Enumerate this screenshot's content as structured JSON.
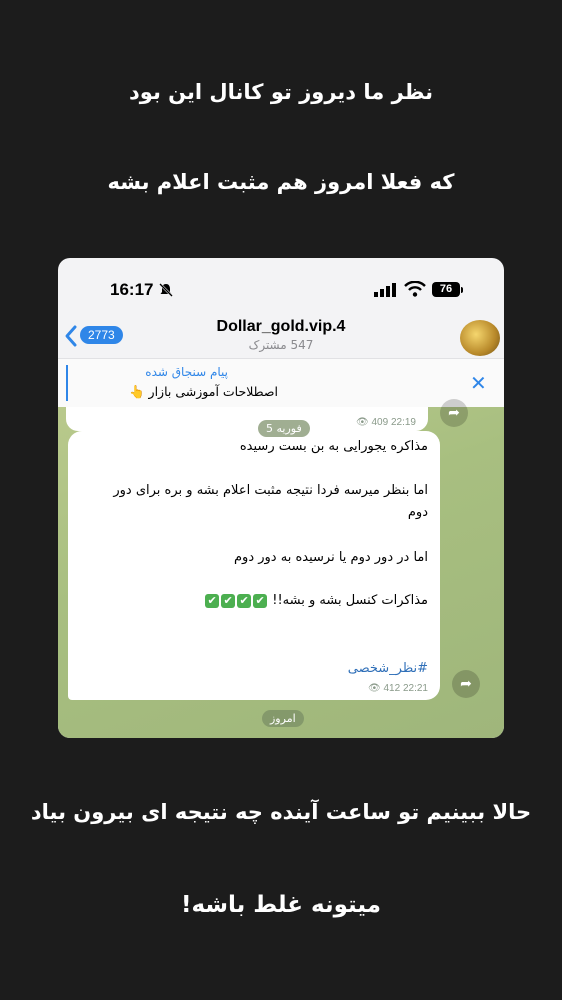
{
  "captions": {
    "line1": "نظر ما دیروز تو کانال این بود",
    "line2": "که فعلا امروز هم مثبت اعلام بشه",
    "line3": "حالا ببینیم تو ساعت آینده چه نتیجه ای بیرون بیاد",
    "line4": "میتونه غلط باشه!"
  },
  "status_bar": {
    "time": "16:17",
    "battery": "76"
  },
  "header": {
    "back_badge": "2773",
    "channel_name": "Dollar_gold.vip.4",
    "subscribers": "547 مشترک"
  },
  "pinned": {
    "label": "پیام سنجاق شده",
    "text": "اصطلاحات آموزشی بازار 👆"
  },
  "messages": {
    "previous": {
      "views": "409",
      "time": "22:19"
    },
    "date_pill": "فوریه 5",
    "current": {
      "line1": "مذاکره یجورایی به بن بست رسیده",
      "line2": "اما بنظر میرسه فردا نتیجه مثبت اعلام بشه و بره برای دور",
      "line3": "دوم",
      "line4": "اما در دور دوم یا نرسیده به دور دوم",
      "line5": "مذاکرات کنسل بشه و بشه!!",
      "hashtag": "#نظر_شخصی",
      "views": "412",
      "time": "22:21"
    },
    "today_pill": "امروز"
  },
  "colors": {
    "accent": "#2f86e8",
    "chat_bg": "#a8bf80",
    "check_emoji": "#4caf50"
  }
}
